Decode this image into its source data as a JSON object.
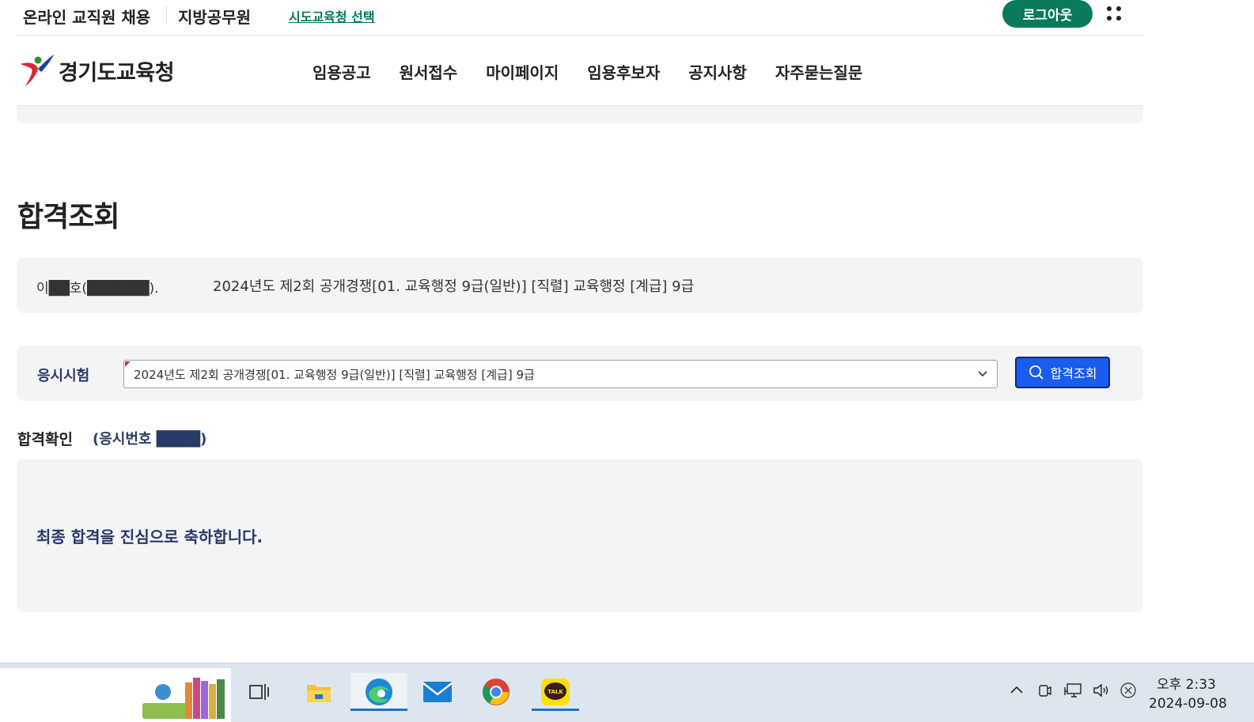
{
  "utility": {
    "site_name": "온라인 교직원 채용",
    "category": "지방공무원",
    "office_select_link": "시도교육청 선택",
    "logout_button": "로그아웃"
  },
  "header": {
    "logo_text": "경기도교육청",
    "nav": [
      "임용공고",
      "원서접수",
      "마이페이지",
      "임용후보자",
      "공지사항",
      "자주묻는질문"
    ]
  },
  "page_title": "합격조회",
  "applicant": {
    "name": "이██호(██████).",
    "exam": "2024년도 제2회 공개경쟁[01. 교육행정 9급(일반)] [직렬] 교육행정 [계급] 9급"
  },
  "exam_select": {
    "label": "응시시험",
    "selected": "2024년도 제2회 공개경쟁[01. 교육행정 9급(일반)] [직렬] 교육행정 [계급] 9급",
    "search_button": "합격조회"
  },
  "result": {
    "label": "합격확인",
    "exam_number_prefix": "(응시번호 ████)",
    "message": "최종 합격을 진심으로 축하합니다."
  },
  "taskbar": {
    "apps": [
      "task-view",
      "file-explorer",
      "edge",
      "mail",
      "chrome",
      "kakaotalk"
    ],
    "time": "오후 2:33",
    "date": "2024-09-08",
    "kakao_label": "TALK"
  },
  "colors": {
    "brand_green": "#0a7a5c",
    "search_blue": "#1a5cf0",
    "navy_text": "#2a3a66",
    "panel_bg": "#f3f4f6"
  }
}
